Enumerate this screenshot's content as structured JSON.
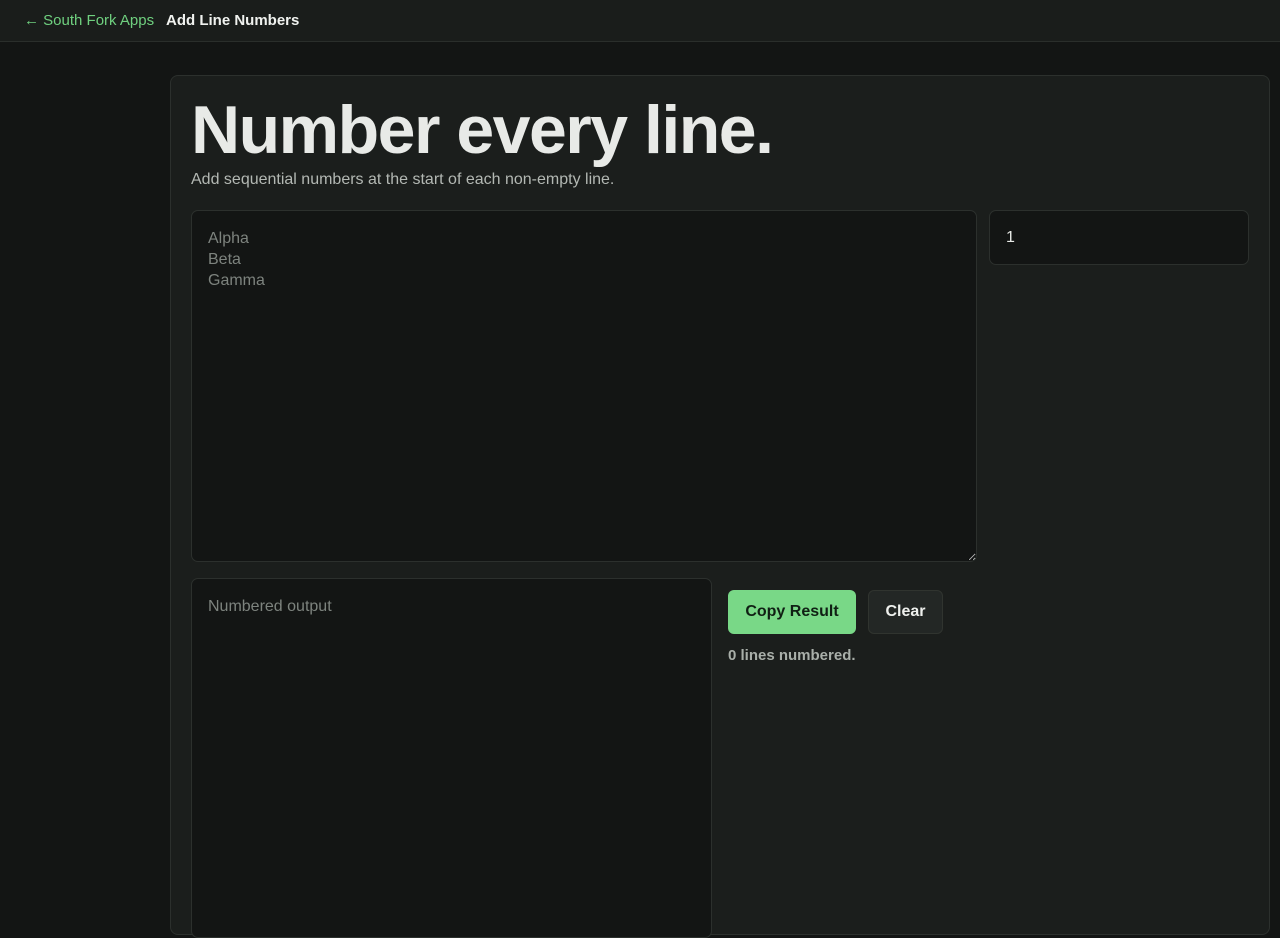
{
  "nav": {
    "back_label": "← South Fork Apps",
    "current_label": "Add Line Numbers"
  },
  "hero": {
    "title": "Number every line.",
    "subtitle": "Add sequential numbers at the start of each non-empty line."
  },
  "input": {
    "value": "",
    "placeholder": "Alpha\nBeta\nGamma"
  },
  "start_number": {
    "value": "1"
  },
  "output": {
    "value": "",
    "placeholder": "Numbered output"
  },
  "actions": {
    "copy_label": "Copy Result",
    "clear_label": "Clear"
  },
  "status": {
    "text": "0 lines numbered."
  },
  "colors": {
    "accent": "#79d887",
    "link": "#6fd07f",
    "background": "#131514",
    "card": "#1b1e1c"
  }
}
